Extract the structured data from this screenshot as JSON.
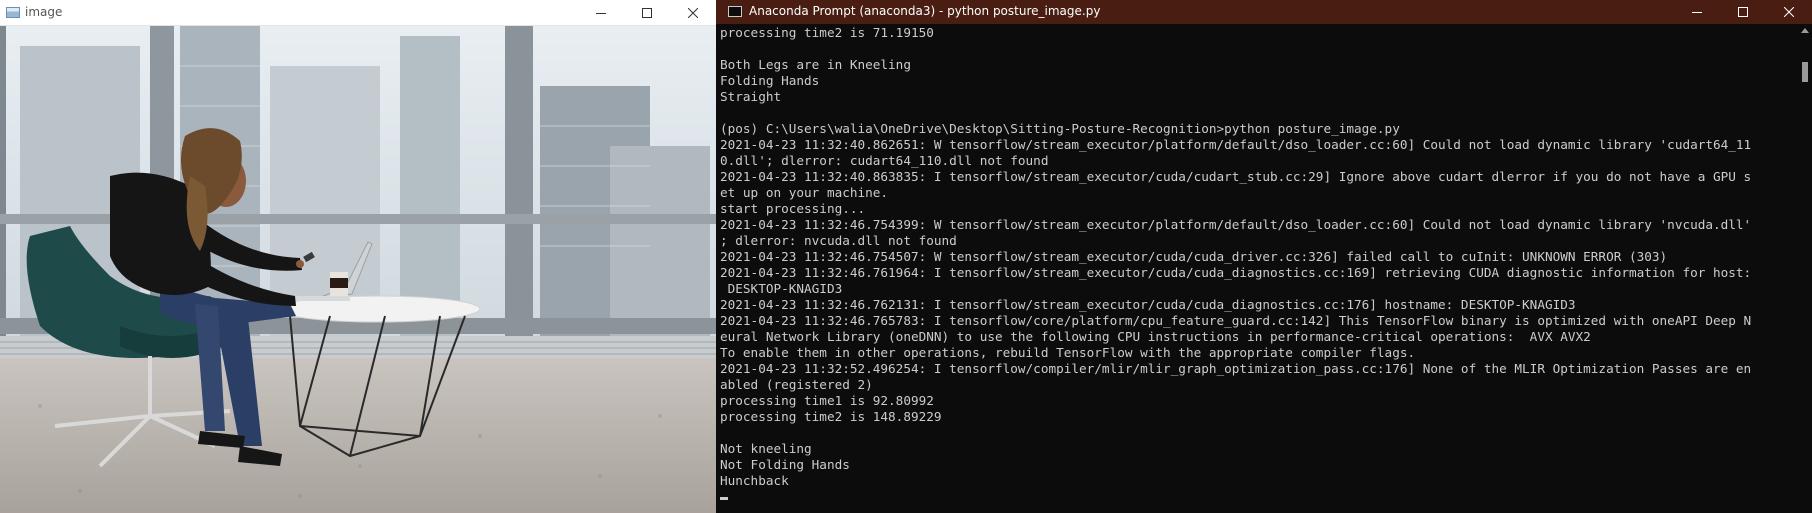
{
  "left_window": {
    "title": "image",
    "controls": [
      "minimize",
      "maximize",
      "close"
    ]
  },
  "right_window": {
    "title": "Anaconda Prompt (anaconda3) - python  posture_image.py",
    "controls": [
      "minimize",
      "maximize",
      "close"
    ],
    "title_bar_color": "#4a1d12"
  },
  "console_lines": [
    "processing time2 is 71.19150",
    "",
    "Both Legs are in Kneeling",
    "Folding Hands",
    "Straight",
    "",
    "(pos) C:\\Users\\walia\\OneDrive\\Desktop\\Sitting-Posture-Recognition>python posture_image.py",
    "2021-04-23 11:32:40.862651: W tensorflow/stream_executor/platform/default/dso_loader.cc:60] Could not load dynamic library 'cudart64_11",
    "0.dll'; dlerror: cudart64_110.dll not found",
    "2021-04-23 11:32:40.863835: I tensorflow/stream_executor/cuda/cudart_stub.cc:29] Ignore above cudart dlerror if you do not have a GPU s",
    "et up on your machine.",
    "start processing...",
    "2021-04-23 11:32:46.754399: W tensorflow/stream_executor/platform/default/dso_loader.cc:60] Could not load dynamic library 'nvcuda.dll'",
    "; dlerror: nvcuda.dll not found",
    "2021-04-23 11:32:46.754507: W tensorflow/stream_executor/cuda/cuda_driver.cc:326] failed call to cuInit: UNKNOWN ERROR (303)",
    "2021-04-23 11:32:46.761964: I tensorflow/stream_executor/cuda/cuda_diagnostics.cc:169] retrieving CUDA diagnostic information for host:",
    " DESKTOP-KNAGID3",
    "2021-04-23 11:32:46.762131: I tensorflow/stream_executor/cuda/cuda_diagnostics.cc:176] hostname: DESKTOP-KNAGID3",
    "2021-04-23 11:32:46.765783: I tensorflow/core/platform/cpu_feature_guard.cc:142] This TensorFlow binary is optimized with oneAPI Deep N",
    "eural Network Library (oneDNN) to use the following CPU instructions in performance-critical operations:  AVX AVX2",
    "To enable them in other operations, rebuild TensorFlow with the appropriate compiler flags.",
    "2021-04-23 11:32:52.496254: I tensorflow/compiler/mlir/mlir_graph_optimization_pass.cc:176] None of the MLIR Optimization Passes are en",
    "abled (registered 2)",
    "processing time1 is 92.80992",
    "processing time2 is 148.89229",
    "",
    "Not kneeling",
    "Not Folding Hands",
    "Hunchback"
  ]
}
